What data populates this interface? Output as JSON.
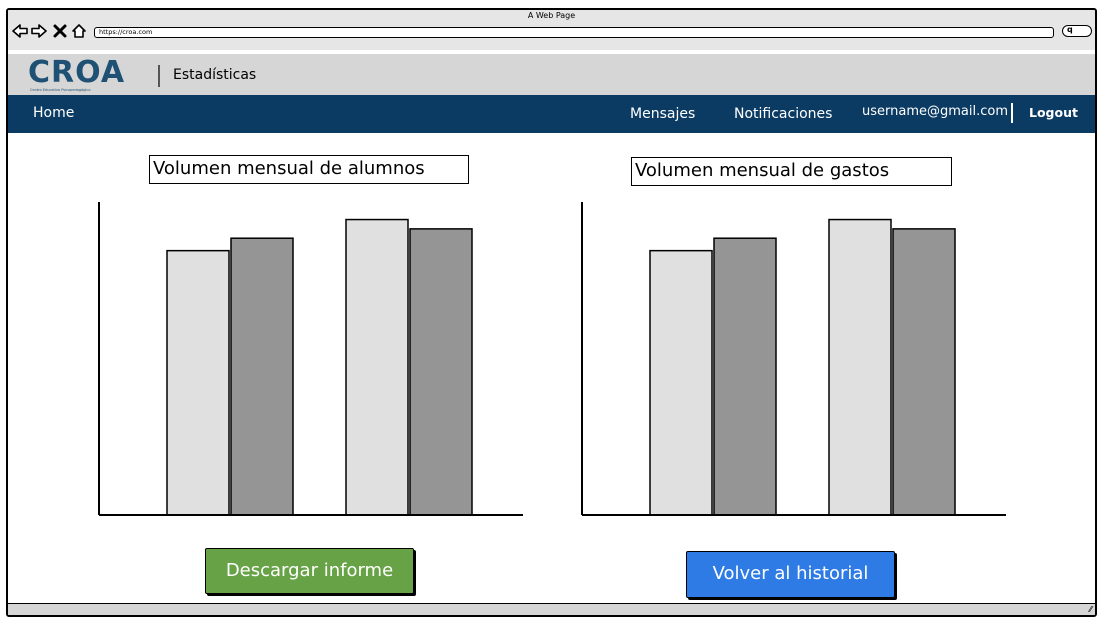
{
  "browser": {
    "window_title": "A Web Page",
    "url": "https://croa.com",
    "icons": [
      "back-arrow-icon",
      "forward-arrow-icon",
      "close-icon",
      "home-icon",
      "search-icon"
    ]
  },
  "header": {
    "logo_text": "CROA",
    "logo_subtitle": "Centro Educativo Psicopedagógico",
    "page_heading": "Estadísticas"
  },
  "nav": {
    "home": "Home",
    "mensajes": "Mensajes",
    "notificaciones": "Notificaciones",
    "user_email": "username@gmail.com",
    "logout": "Logout"
  },
  "charts": {
    "alumnos_title": "Volumen mensual de alumnos",
    "gastos_title": "Volumen mensual de gastos"
  },
  "chart_data": [
    {
      "type": "bar",
      "title": "Volumen mensual de alumnos",
      "categories": [
        "",
        ""
      ],
      "series": [
        {
          "values": [
            85,
            89
          ]
        },
        {
          "values": [
            95,
            92
          ]
        }
      ],
      "colors": [
        "#e0e0e0",
        "#959595"
      ],
      "ylim": [
        0,
        100
      ]
    },
    {
      "type": "bar",
      "title": "Volumen mensual de gastos",
      "categories": [
        "",
        ""
      ],
      "series": [
        {
          "values": [
            85,
            89
          ]
        },
        {
          "values": [
            95,
            92
          ]
        }
      ],
      "colors": [
        "#e0e0e0",
        "#959595"
      ],
      "ylim": [
        0,
        100
      ]
    }
  ],
  "buttons": {
    "descargar": "Descargar informe",
    "volver": "Volver al historial"
  },
  "colors": {
    "navbar": "#0b3b63",
    "logo": "#1f5174",
    "download_button": "#67a346",
    "back_button": "#2e7be6"
  }
}
